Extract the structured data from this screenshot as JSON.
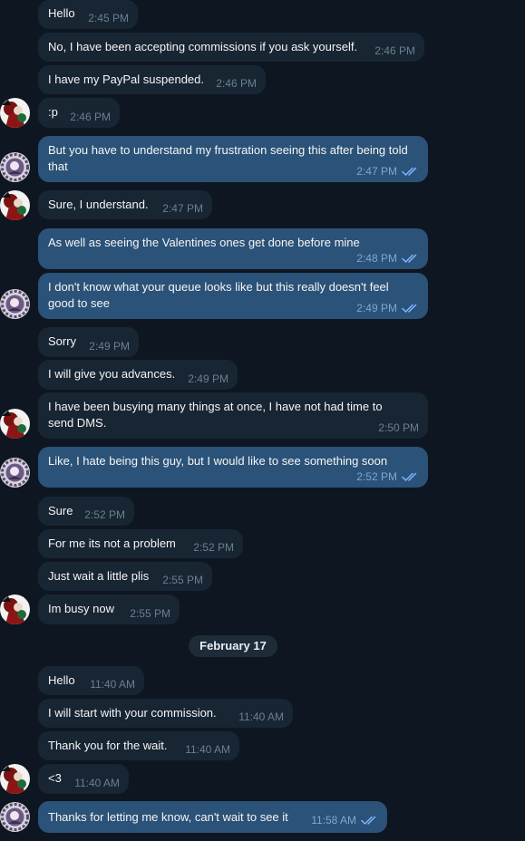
{
  "colors": {
    "background": "#0e1621",
    "incoming_bubble": "#182533",
    "outgoing_bubble": "#2b5278",
    "incoming_time": "#6d7f8f",
    "outgoing_time": "#7da8d3",
    "read_checks": "#7db7ff"
  },
  "date_separator": "February 17",
  "messages": [
    {
      "dir": "in",
      "text": "Hello",
      "time": "2:45 PM"
    },
    {
      "dir": "in",
      "text": "No, I have been accepting commissions if you ask yourself.",
      "time": "2:46 PM"
    },
    {
      "dir": "in",
      "text": "I have my PayPal suspended.",
      "time": "2:46 PM"
    },
    {
      "dir": "in",
      "text": ":p",
      "time": "2:46 PM"
    },
    {
      "dir": "out",
      "text": "But you have to understand my frustration seeing this after being told that",
      "time": "2:47 PM",
      "read": true
    },
    {
      "dir": "in",
      "text": "Sure, I understand.",
      "time": "2:47 PM"
    },
    {
      "dir": "out",
      "text": "As well as seeing the Valentines ones get done before mine",
      "time": "2:48 PM",
      "read": true
    },
    {
      "dir": "out",
      "text": "I don't know what your queue looks like but this really doesn't feel good to see",
      "time": "2:49 PM",
      "read": true
    },
    {
      "dir": "in",
      "text": "Sorry",
      "time": "2:49 PM"
    },
    {
      "dir": "in",
      "text": "I will give you advances.",
      "time": "2:49 PM"
    },
    {
      "dir": "in",
      "text": "I have been busying many things at once, I have not had time to send DMS.",
      "time": "2:50 PM"
    },
    {
      "dir": "out",
      "text": "Like, I hate being this guy, but I would like to see something soon",
      "time": "2:52 PM",
      "read": true
    },
    {
      "dir": "in",
      "text": "Sure",
      "time": "2:52 PM"
    },
    {
      "dir": "in",
      "text": "For me its not a problem",
      "time": "2:52 PM"
    },
    {
      "dir": "in",
      "text": "Just wait a little plis",
      "time": "2:55 PM"
    },
    {
      "dir": "in",
      "text": "Im busy now",
      "time": "2:55 PM"
    },
    {
      "dir": "in",
      "text": "Hello",
      "time": "11:40 AM"
    },
    {
      "dir": "in",
      "text": "I will start with your commission.",
      "time": "11:40 AM"
    },
    {
      "dir": "in",
      "text": "Thank you for the wait.",
      "time": "11:40 AM"
    },
    {
      "dir": "in",
      "text": "<3",
      "time": "11:40 AM"
    },
    {
      "dir": "out",
      "text": "Thanks for letting me know, can't wait to see it",
      "time": "11:58 AM",
      "read": true
    }
  ],
  "avatars": [
    {
      "user": "other",
      "icon": "red-character-avatar-icon"
    },
    {
      "user": "self",
      "icon": "circular-portrait-avatar-icon"
    },
    {
      "user": "other",
      "icon": "red-character-avatar-icon"
    },
    {
      "user": "self",
      "icon": "circular-portrait-avatar-icon"
    },
    {
      "user": "other",
      "icon": "red-character-avatar-icon"
    },
    {
      "user": "self",
      "icon": "circular-portrait-avatar-icon"
    },
    {
      "user": "other",
      "icon": "red-character-avatar-icon"
    },
    {
      "user": "other",
      "icon": "red-character-avatar-icon"
    },
    {
      "user": "self",
      "icon": "circular-portrait-avatar-icon"
    }
  ]
}
